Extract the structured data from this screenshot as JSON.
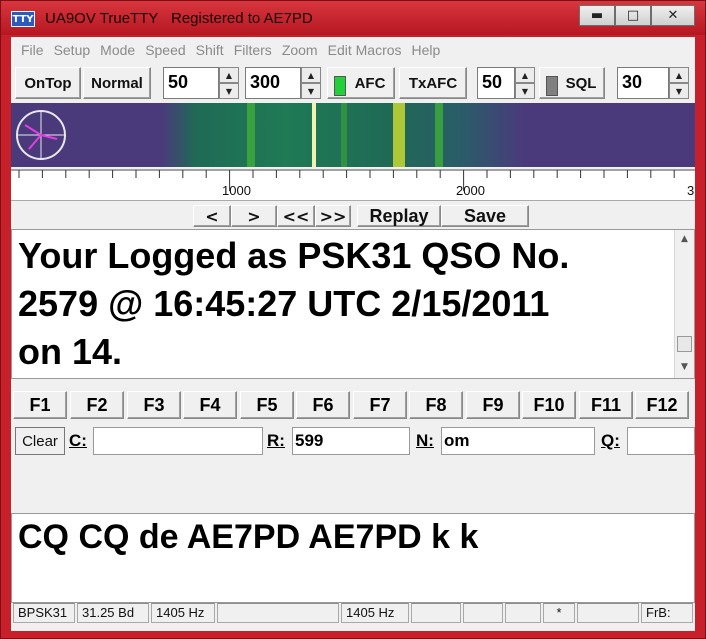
{
  "window": {
    "app_title": "UA9OV TrueTTY",
    "registered": "Registered to AE7PD",
    "icon_label": "TTY",
    "minimize_glyph": "▬",
    "maximize_glyph": "□",
    "close_glyph": "✕"
  },
  "menu": [
    "File",
    "Setup",
    "Mode",
    "Speed",
    "Shift",
    "Filters",
    "Zoom",
    "Edit Macros",
    "Help"
  ],
  "toolbar": {
    "ontop_label": "OnTop",
    "normal_label": "Normal",
    "speed_value": "50",
    "shift_value": "300",
    "afc_label": "AFC",
    "afc_led_color": "#22d13a",
    "txafc_label": "TxAFC",
    "tx_value": "50",
    "sql_label": "SQL",
    "sql_led_color": "#808080",
    "sql_value": "30",
    "spin_up_glyph": "▲",
    "spin_down_glyph": "▼"
  },
  "scale": {
    "labels": [
      "1000",
      "2000",
      "3"
    ]
  },
  "playback": {
    "prev_label": "<",
    "next_label": ">",
    "rewind_label": "<<",
    "forward_label": ">>",
    "replay_label": "Replay",
    "save_label": "Save"
  },
  "rx": {
    "lines": [
      "Your Logged as PSK31 QSO No.",
      "2579 @ 16:45:27 UTC 2/15/2011",
      "on 14."
    ],
    "scroll_up_glyph": "▲",
    "scroll_down_glyph": "▼"
  },
  "fkeys": [
    "F1",
    "F2",
    "F3",
    "F4",
    "F5",
    "F6",
    "F7",
    "F8",
    "F9",
    "F10",
    "F11",
    "F12"
  ],
  "log": {
    "clear_label": "Clear",
    "call_label": "C:",
    "call_value": "",
    "rst_label": "R:",
    "rst_value": "599",
    "name_label": "N:",
    "name_value": "om",
    "qth_label": "Q:",
    "qth_value": ""
  },
  "tx": {
    "text": "CQ CQ de AE7PD AE7PD k k"
  },
  "status": {
    "mode": "BPSK31",
    "baud": "31.25 Bd",
    "freq1": "1405 Hz",
    "freq2": "1405 Hz",
    "star": "*",
    "frb": "FrB:"
  }
}
